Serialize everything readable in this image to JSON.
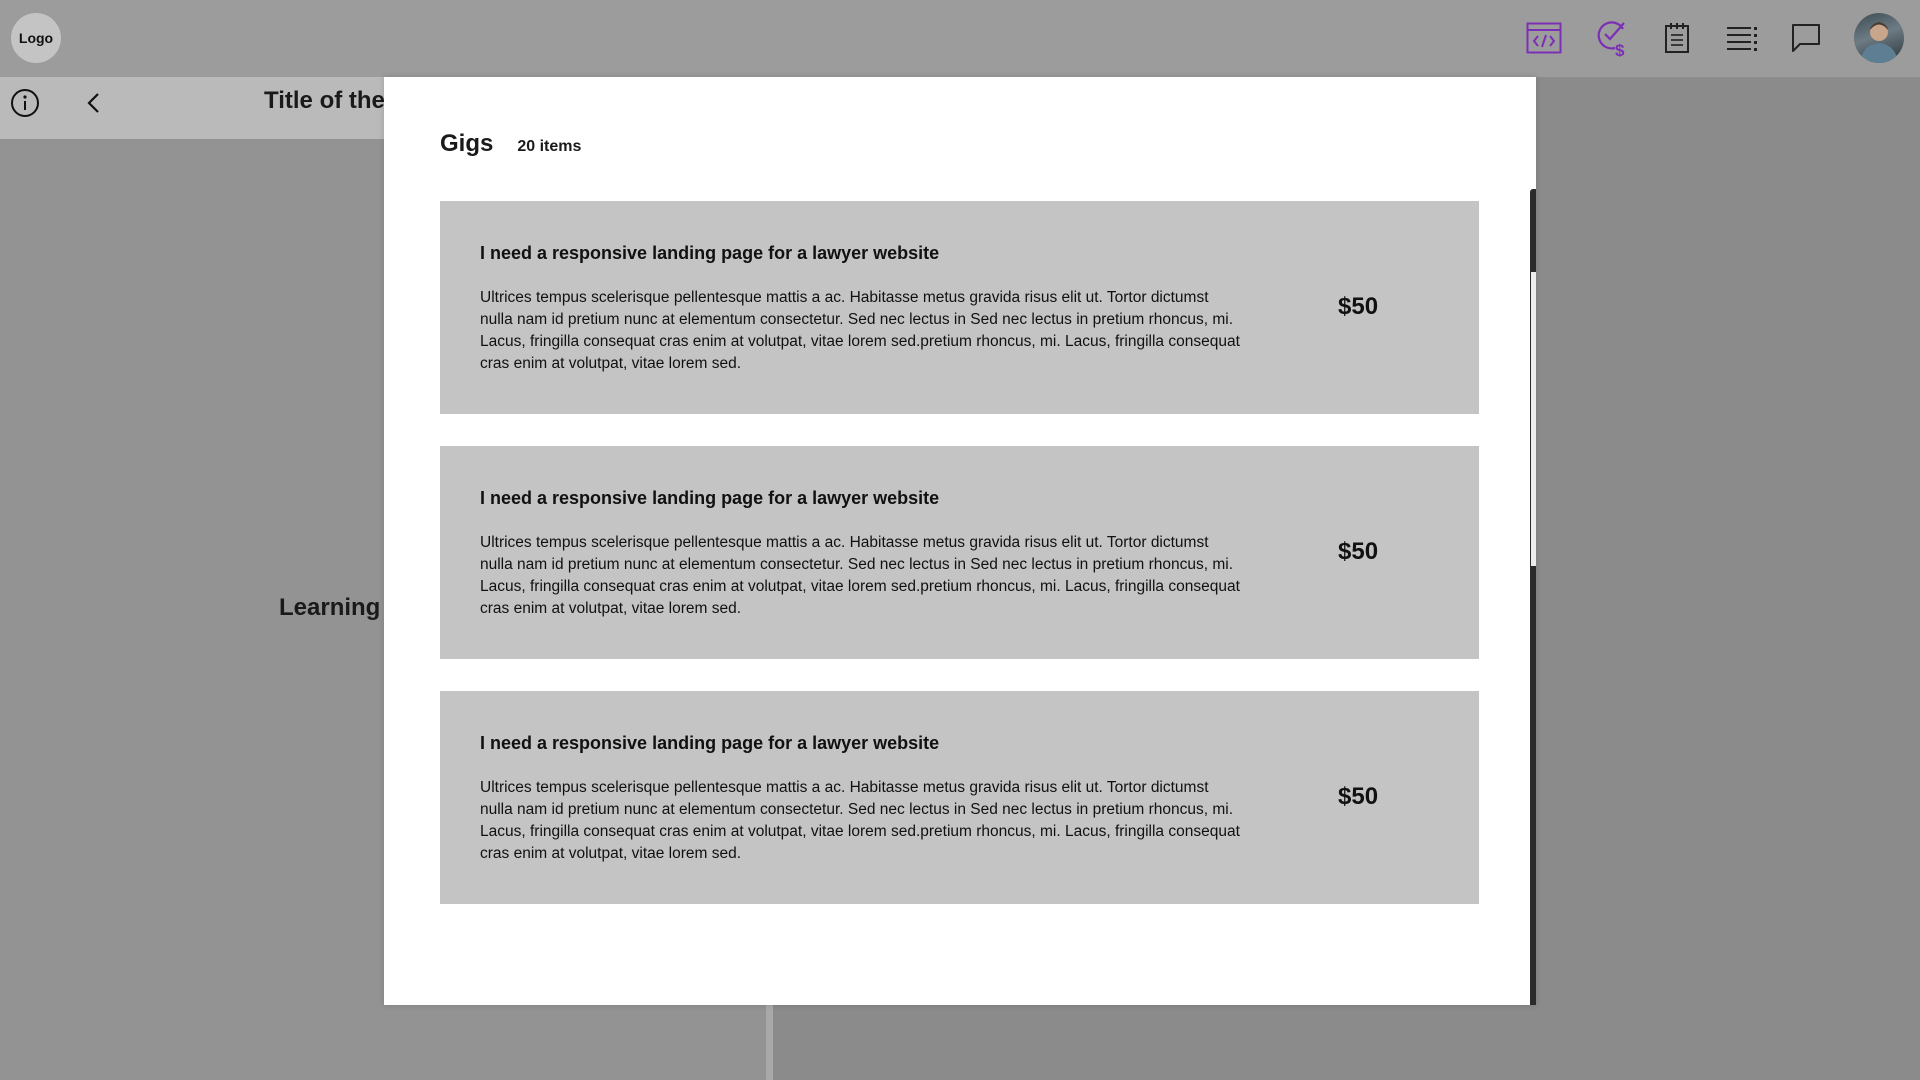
{
  "app": {
    "logo_label": "Logo",
    "page_title": "Title of the",
    "learning_label": "Learning l"
  },
  "topbar": {
    "icons": [
      "code-icon",
      "check-dollar-icon",
      "notepad-icon",
      "list-icon",
      "chat-icon"
    ],
    "accent_color": "#7b2fb5"
  },
  "modal": {
    "title": "Gigs",
    "count": "20 items",
    "gigs": [
      {
        "title": "I need a responsive landing page for a lawyer website",
        "description": "Ultrices tempus scelerisque pellentesque mattis a ac. Habitasse metus gravida risus elit ut. Tortor dictumst nulla nam id pretium nunc at elementum consectetur. Sed nec lectus in Sed nec lectus in pretium rhoncus, mi. Lacus, fringilla consequat cras enim at volutpat, vitae lorem sed.pretium rhoncus, mi. Lacus, fringilla consequat cras enim at volutpat, vitae lorem sed.",
        "price": "$50"
      },
      {
        "title": "I need a responsive landing page for a lawyer website",
        "description": "Ultrices tempus scelerisque pellentesque mattis a ac. Habitasse metus gravida risus elit ut. Tortor dictumst nulla nam id pretium nunc at elementum consectetur. Sed nec lectus in Sed nec lectus in pretium rhoncus, mi. Lacus, fringilla consequat cras enim at volutpat, vitae lorem sed.pretium rhoncus, mi. Lacus, fringilla consequat cras enim at volutpat, vitae lorem sed.",
        "price": "$50"
      },
      {
        "title": "I need a responsive landing page for a lawyer website",
        "description": "Ultrices tempus scelerisque pellentesque mattis a ac. Habitasse metus gravida risus elit ut. Tortor dictumst nulla nam id pretium nunc at elementum consectetur. Sed nec lectus in Sed nec lectus in pretium rhoncus, mi. Lacus, fringilla consequat cras enim at volutpat, vitae lorem sed.pretium rhoncus, mi. Lacus, fringilla consequat cras enim at volutpat, vitae lorem sed.",
        "price": "$50"
      }
    ]
  }
}
